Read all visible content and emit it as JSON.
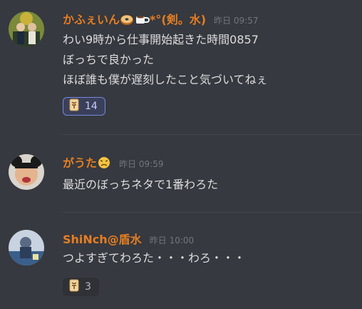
{
  "messages": [
    {
      "username_text": "かふぇいん",
      "username_suffix": "*°(剣。水)",
      "timestamp": "昨日 09:57",
      "lines": [
        "わい9時から仕事開始起きた時間0857",
        "ぼっちで良かった",
        "ほぼ誰も僕が遅刻したこと気づいてねぇ"
      ],
      "reaction": {
        "icon": "mahjong-tile-emoji",
        "count": "14"
      }
    },
    {
      "username_text": "がうた",
      "timestamp": "昨日 09:59",
      "lines": [
        "最近のぼっちネタで1番わろた"
      ]
    },
    {
      "username_text": "ShiNch@盾水",
      "timestamp": "昨日 10:00",
      "lines": [
        "つよすぎてわろた・・・わろ・・・"
      ],
      "reaction": {
        "icon": "mahjong-tile-emoji",
        "count": "3"
      }
    }
  ],
  "colors": {
    "username": "#e67e22",
    "text": "#dcddde",
    "timestamp": "#72767d",
    "background": "#36393f"
  }
}
